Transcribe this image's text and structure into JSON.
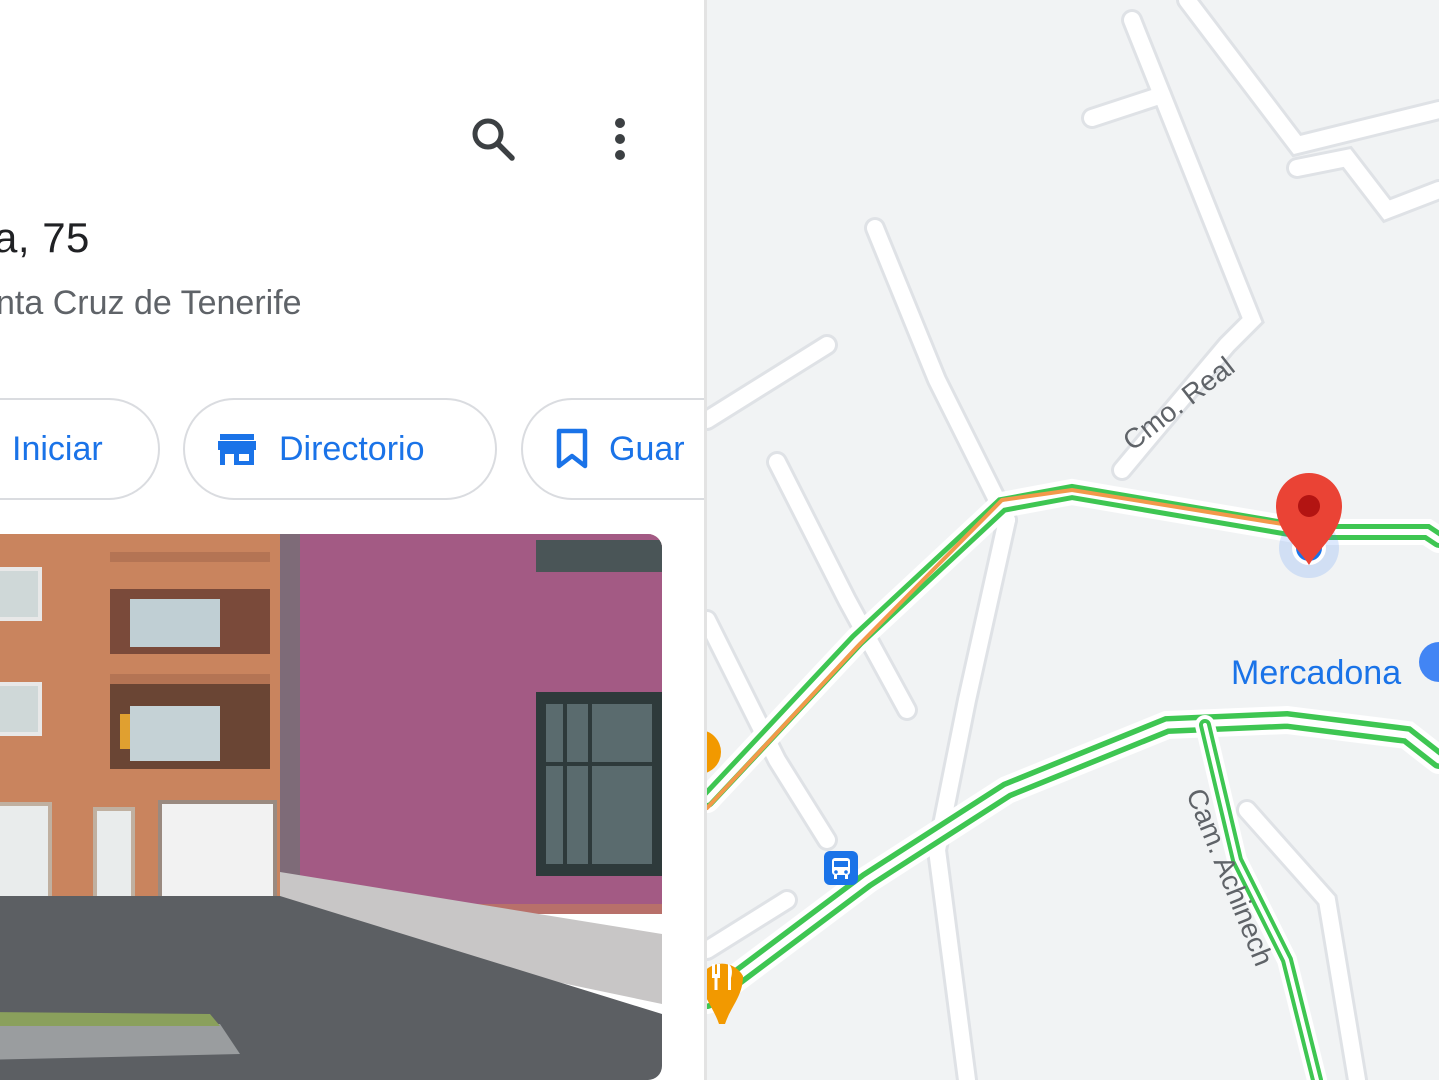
{
  "panel": {
    "title": "a, 75",
    "subtitle": "nta Cruz de Tenerife",
    "toolbar": {
      "search_icon": "search-icon",
      "more_icon": "more-vert-icon"
    },
    "actions": [
      {
        "label": "Iniciar",
        "icon": "navigation-icon"
      },
      {
        "label": "Directorio",
        "icon": "storefront-icon"
      },
      {
        "label": "Guar",
        "icon": "bookmark-icon"
      }
    ],
    "photo": {
      "type": "street-view"
    }
  },
  "map": {
    "place_label": "Mercadona",
    "street_labels": [
      "Cmo. Real",
      "Cam. Achinech"
    ],
    "pins": [
      "location-pin-icon",
      "bus-stop-icon",
      "restaurant-icon"
    ],
    "colors": {
      "accent": "#1a73e8",
      "traffic_green": "#3ec652",
      "traffic_orange": "#f2994a",
      "pin_red": "#ea4335",
      "restaurant_orange": "#f29900",
      "map_background": "#f1f3f4"
    }
  }
}
